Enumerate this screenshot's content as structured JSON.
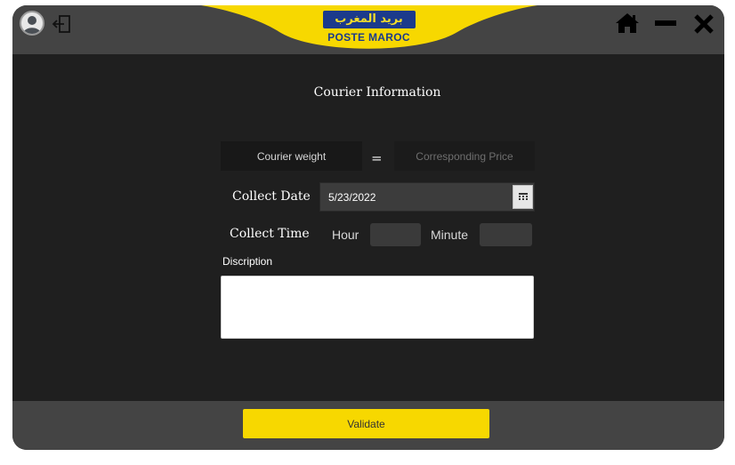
{
  "header": {
    "logo_arabic": "بريد المغرب",
    "logo_french": "POSTE MAROC",
    "brand_color": "#f7d800",
    "logo_blue": "#1b3a8c",
    "icons": [
      "avatar-icon",
      "logout-icon",
      "home-icon",
      "minimize-icon",
      "close-icon"
    ]
  },
  "form": {
    "title": "Courier Information",
    "weight_placeholder": "Courier weight",
    "equals_sign": "=",
    "price_placeholder": "Corresponding Price",
    "collect_date_label": "Collect Date",
    "collect_date_value": "5/23/2022",
    "collect_time_label": "Collect Time",
    "hour_label": "Hour",
    "minute_label": "Minute",
    "hour_value": "",
    "minute_value": "",
    "description_label": "Discription",
    "description_value": ""
  },
  "footer": {
    "validate_label": "Validate"
  }
}
